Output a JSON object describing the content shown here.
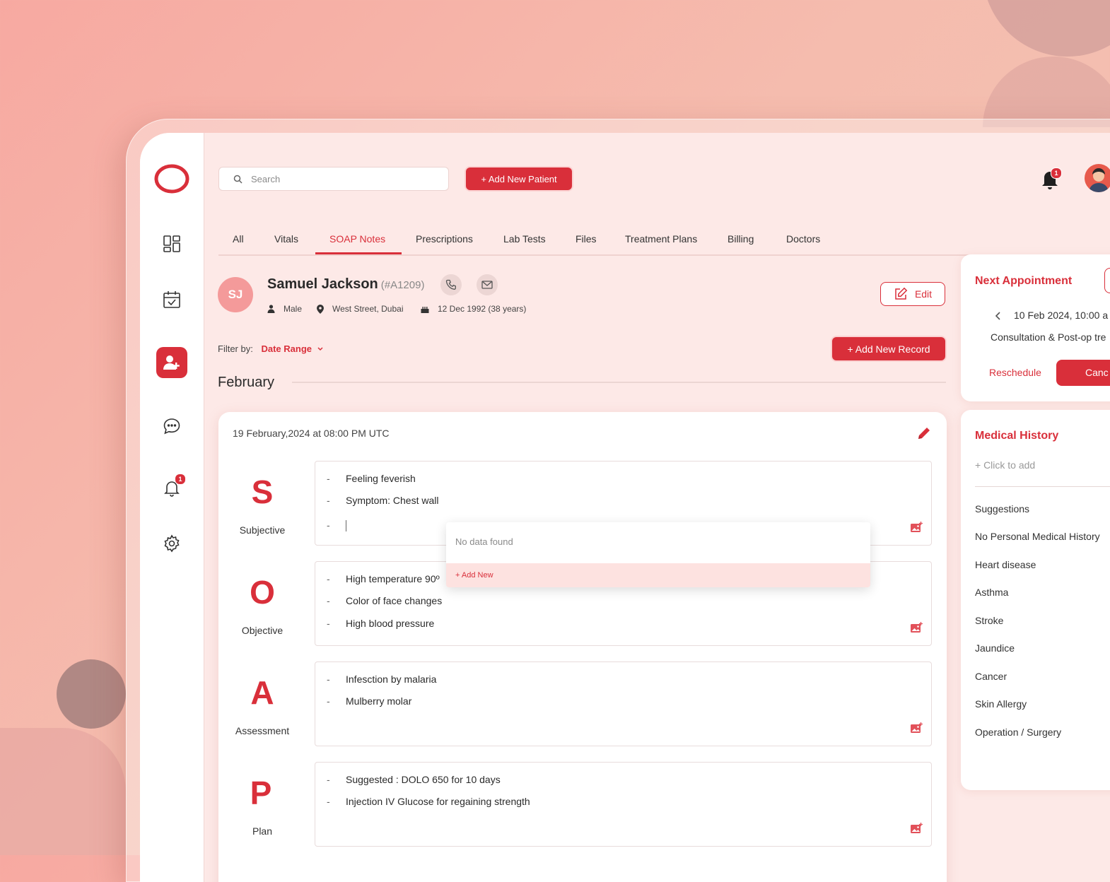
{
  "search": {
    "placeholder": "Search"
  },
  "header": {
    "add_patient_label": "+ Add New Patient",
    "notifications_count": "1"
  },
  "sidebar": {
    "notifications_count": "1"
  },
  "tabs": [
    {
      "label": "All"
    },
    {
      "label": "Vitals"
    },
    {
      "label": "SOAP Notes"
    },
    {
      "label": "Prescriptions"
    },
    {
      "label": "Lab Tests"
    },
    {
      "label": "Files"
    },
    {
      "label": "Treatment Plans"
    },
    {
      "label": "Billing"
    },
    {
      "label": "Doctors"
    }
  ],
  "patient": {
    "initials": "SJ",
    "name": "Samuel Jackson",
    "id": "(#A1209)",
    "gender": "Male",
    "address": "West Street, Dubai",
    "dob": "12 Dec 1992 (38 years)",
    "edit_label": "Edit"
  },
  "filter": {
    "label": "Filter by:",
    "value": "Date Range"
  },
  "add_record_label": "+ Add New Record",
  "month": "February",
  "record": {
    "datetime": "19 February,2024 at 08:00 PM UTC",
    "soap": [
      {
        "letter": "S",
        "label": "Subjective",
        "items": [
          "Feeling feverish",
          "Symptom: Chest wall"
        ]
      },
      {
        "letter": "O",
        "label": "Objective",
        "items": [
          "High temperature 90º",
          "Color of face changes",
          "High blood pressure"
        ]
      },
      {
        "letter": "A",
        "label": "Assessment",
        "items": [
          "Infesction by malaria",
          "Mulberry molar"
        ]
      },
      {
        "letter": "P",
        "label": "Plan",
        "items": [
          "Suggested : DOLO 650 for 10 days",
          "Injection IV Glucose for regaining strength"
        ]
      }
    ],
    "dropdown": {
      "empty": "No data found",
      "add_new": "+ Add New"
    }
  },
  "next_appointment": {
    "title": "Next Appointment",
    "datetime": "10 Feb 2024, 10:00 a",
    "description": "Consultation & Post-op tre",
    "reschedule_label": "Reschedule",
    "cancel_label": "Canc"
  },
  "medical_history": {
    "title": "Medical History",
    "click_to_add": "+ Click to add",
    "suggestions_label": "Suggestions",
    "items": [
      "No Personal Medical History",
      "Heart disease",
      "Asthma",
      "Stroke",
      "Jaundice",
      "Cancer",
      "Skin Allergy",
      "Operation / Surgery"
    ]
  },
  "colors": {
    "accent": "#d92f3a",
    "background": "#fde9e7"
  }
}
